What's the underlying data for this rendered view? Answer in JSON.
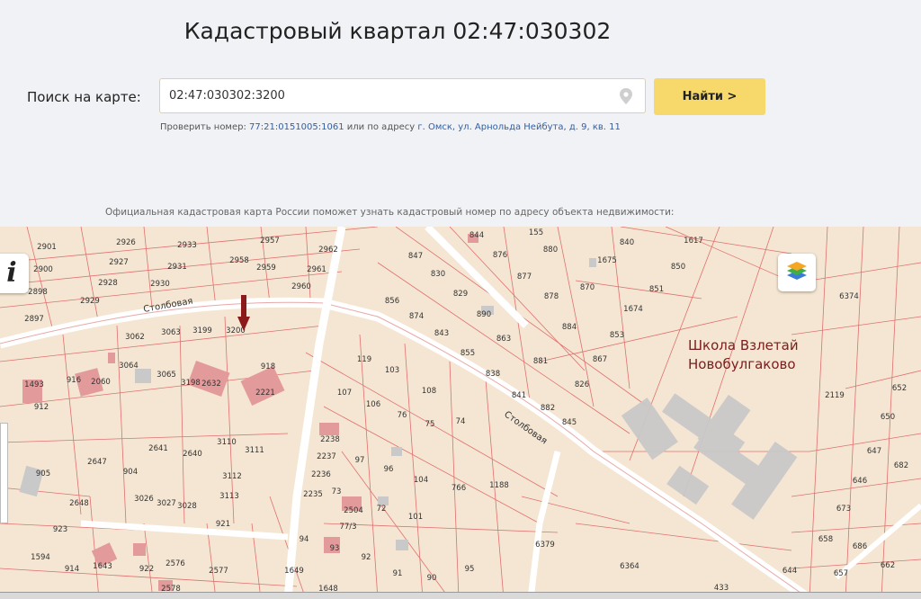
{
  "header": {
    "title": "Кадастровый квартал 02:47:030302"
  },
  "search": {
    "label": "Поиск на карте:",
    "value": "02:47:030302:3200",
    "button_label": "Найти >",
    "hint_prefix": "Проверить номер:",
    "hint_number": "77:21:0151005:1061",
    "hint_middle": "или по адресу",
    "hint_address": "г. Омск, ул. Арнольда Нейбута, д. 9, кв. 11"
  },
  "info_text": "Официальная кадастровая карта России поможет узнать кадастровый номер по адресу объекта недвижимости:",
  "map": {
    "info_button_label": "i",
    "school_line1": "Школа Взлетай",
    "school_line2": "Новобулгаково",
    "street_name": "Столбовая",
    "colors": {
      "background": "#f4e6d2",
      "parcel_border": "#e07070",
      "road": "#ffffff",
      "building": "#e39a9a",
      "school_building": "#c9c9c9"
    },
    "parcel_labels": [
      "2901",
      "2926",
      "2933",
      "2957",
      "2962",
      "2900",
      "2927",
      "2931",
      "2958",
      "2959",
      "2961",
      "2898",
      "2928",
      "2930",
      "2960",
      "2929",
      "2897",
      "3062",
      "3063",
      "3199",
      "3200",
      "918",
      "3064",
      "3065",
      "3198",
      "2632",
      "2221",
      "916",
      "2060",
      "912",
      "1493",
      "2641",
      "2640",
      "3110",
      "3111",
      "3112",
      "3113",
      "904",
      "3026",
      "3027",
      "3028",
      "921",
      "2647",
      "905",
      "2648",
      "923",
      "1594",
      "914",
      "1643",
      "922",
      "2576",
      "2577",
      "2578",
      "1649",
      "1648",
      "94",
      "93",
      "92",
      "91",
      "90",
      "95",
      "2238",
      "2237",
      "2236",
      "2235",
      "2504",
      "72",
      "73",
      "97",
      "96",
      "104",
      "101",
      "766",
      "1188",
      "107",
      "106",
      "76",
      "75",
      "74",
      "119",
      "103",
      "108",
      "856",
      "874",
      "843",
      "855",
      "838",
      "841",
      "882",
      "845",
      "830",
      "829",
      "847",
      "844",
      "876",
      "877",
      "878",
      "870",
      "890",
      "863",
      "881",
      "884",
      "867",
      "826",
      "853",
      "880",
      "840",
      "1617",
      "850",
      "851",
      "1675",
      "1674",
      "155",
      "6374",
      "2119",
      "652",
      "650",
      "647",
      "682",
      "646",
      "673",
      "658",
      "686",
      "662",
      "657",
      "644",
      "433",
      "6379",
      "6364",
      "77/3"
    ]
  }
}
